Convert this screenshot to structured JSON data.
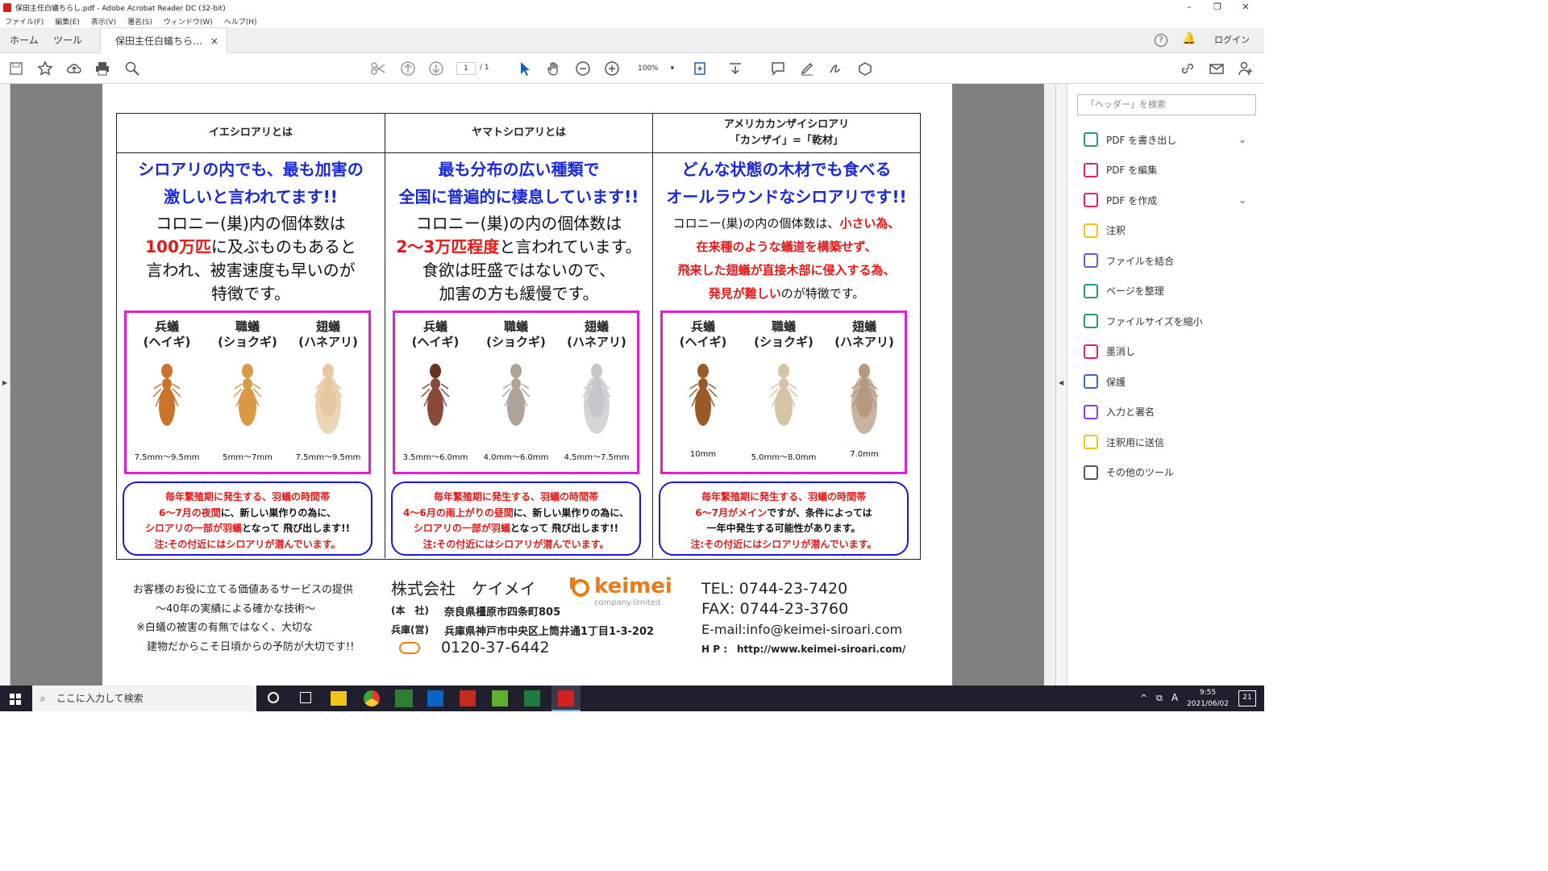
{
  "window": {
    "title": "保田主任白蟻ちらし.pdf - Adobe Acrobat Reader DC (32-bit)",
    "minimize": "–",
    "maximize": "❐",
    "close": "✕"
  },
  "menu": [
    "ファイル(F)",
    "編集(E)",
    "表示(V)",
    "署名(S)",
    "ウィンドウ(W)",
    "ヘルプ(H)"
  ],
  "tabs": {
    "home": "ホーム",
    "tools": "ツール",
    "doc": "保田主任白蟻ちら…",
    "close": "×",
    "login": "ログイン"
  },
  "toolbar": {
    "page_current": "1",
    "page_total": "/ 1",
    "zoom": "100%"
  },
  "doc": {
    "columns": [
      {
        "head": [
          "イエシロアリとは"
        ],
        "catch": "シロアリの内でも、最も加害の\n激しいと言われてます!!",
        "desc": [
          {
            "t": "コロニー(巣)内の個体数は"
          },
          {
            "t": "100万匹",
            "r": true,
            "tail": "に及ぶものもあると"
          },
          {
            "t": "言われ、被害速度も早いのが"
          },
          {
            "t": "特徴です。"
          }
        ],
        "castes": [
          "兵蟻\n(ヘイギ)",
          "職蟻\n(ショクギ)",
          "翅蟻\n(ハネアリ)"
        ],
        "sizes": [
          "7.5mm～9.5mm",
          "5mm～7mm",
          "7.5mm～9.5mm"
        ],
        "note": [
          {
            "t": "毎年繁殖期に発生する、羽蟻の時間帯",
            "c": "red"
          },
          {
            "t": "6～7月の夜間",
            "c": "red",
            "tail": "に、新しい巣作りの為に、"
          },
          {
            "t": "シロアリの一部が羽蟻",
            "c": "red",
            "tail": "となって 飛び出します!!"
          },
          {
            "t": "注:その付近にはシロアリが潜んでいます。",
            "c": "red"
          }
        ]
      },
      {
        "head": [
          "ヤマトシロアリとは"
        ],
        "catch": "最も分布の広い種類で\n全国に普遍的に棲息しています!!",
        "desc": [
          {
            "t": "コロニー(巣)の内の個体数は"
          },
          {
            "t": "2～3万匹程度",
            "r": true,
            "tail": "と言われています。"
          },
          {
            "t": "食欲は旺盛ではないので、"
          },
          {
            "t": "加害の方も緩慢です。"
          }
        ],
        "castes": [
          "兵蟻\n(ヘイギ)",
          "職蟻\n(ショクギ)",
          "翅蟻\n(ハネアリ)"
        ],
        "sizes": [
          "3.5mm～6.0mm",
          "4.0mm～6.0mm",
          "4.5mm～7.5mm"
        ],
        "note": [
          {
            "t": "毎年繁殖期に発生する、羽蟻の時間帯",
            "c": "red"
          },
          {
            "t": "4～6月の雨上がりの昼間",
            "c": "red",
            "tail": "に、新しい巣作りの為に、"
          },
          {
            "t": "シロアリの一部が羽蟻",
            "c": "red",
            "tail": "となって 飛び出します!!"
          },
          {
            "t": "注:その付近にはシロアリが潜んでいます。",
            "c": "red"
          }
        ]
      },
      {
        "head": [
          "アメリカカンザイシロアリ",
          "「カンザイ」=「乾材」"
        ],
        "catch": "どんな状態の木材でも食べる\nオールラウンドなシロアリです!!",
        "desc": [
          {
            "t": "コロニー(巣)の内の個体数は、",
            "tail": "小さい為、",
            "tailred": true
          },
          {
            "t": "在来種のような蟻道を構築せず、",
            "r": true
          },
          {
            "t": "飛来した翅蟻が直接木部に侵入する為、",
            "r": true
          },
          {
            "t": "発見が難しい",
            "r": true,
            "tail": "のが特徴です。"
          }
        ],
        "castes": [
          "兵蟻\n(ヘイギ)",
          "職蟻\n(ショクギ)",
          "翅蟻\n(ハネアリ)"
        ],
        "sizes": [
          "10mm",
          "5.0mm～8.0mm",
          "7.0mm"
        ],
        "note": [
          {
            "t": "毎年繁殖期に発生する、羽蟻の時間帯",
            "c": "red"
          },
          {
            "t": "6～7月がメイン",
            "c": "red",
            "tail": "ですが、条件によっては"
          },
          {
            "t": "一年中発生する可能性があります。",
            "c": "black"
          },
          {
            "t": "注:その付近にはシロアリが潜んでいます。",
            "c": "red"
          }
        ]
      }
    ],
    "footer": {
      "left": [
        "お客様のお役に立てる価値あるサービスの提供",
        "～40年の実績による確かな技術～",
        "※白蟻の被害の有無ではなく、大切な",
        "建物だからこそ日頃からの予防が大切です!!"
      ],
      "company": "株式会社　ケイメイ",
      "brand": "keimei",
      "brand_sub": "company.limited",
      "hq_label": "(本　社)",
      "hq": "奈良県橿原市四条町805",
      "br_label": "兵庫(営)",
      "br": "兵庫県神戸市中央区上筒井通1丁目1-3-202",
      "free": "0120-37-6442",
      "tel": "TEL: 0744-23-7420",
      "fax": "FAX: 0744-23-3760",
      "email": "E-mail:info@keimei-siroari.com",
      "hp": "H P :　http://www.keimei-siroari.com/"
    }
  },
  "rpanel": {
    "search": "「ヘッダー」を検索",
    "items": [
      "PDF を書き出し",
      "PDF を編集",
      "PDF を作成",
      "注釈",
      "ファイルを結合",
      "ページを整理",
      "ファイルサイズを縮小",
      "墨消し",
      "保護",
      "入力と署名",
      "注釈用に送信",
      "その他のツール"
    ],
    "colors": [
      "#2a9a6e",
      "#e0245e",
      "#e0245e",
      "#f2c21d",
      "#7a52d6",
      "#2a9a6e",
      "#2a9a6e",
      "#e0245e",
      "#3a68c9",
      "#8a3fd6",
      "#f2c21d",
      "#555"
    ]
  },
  "taskbar": {
    "search": "ここに入力して検索",
    "time": "9:55",
    "date": "2021/06/02",
    "badge": "21",
    "ime": "A"
  }
}
